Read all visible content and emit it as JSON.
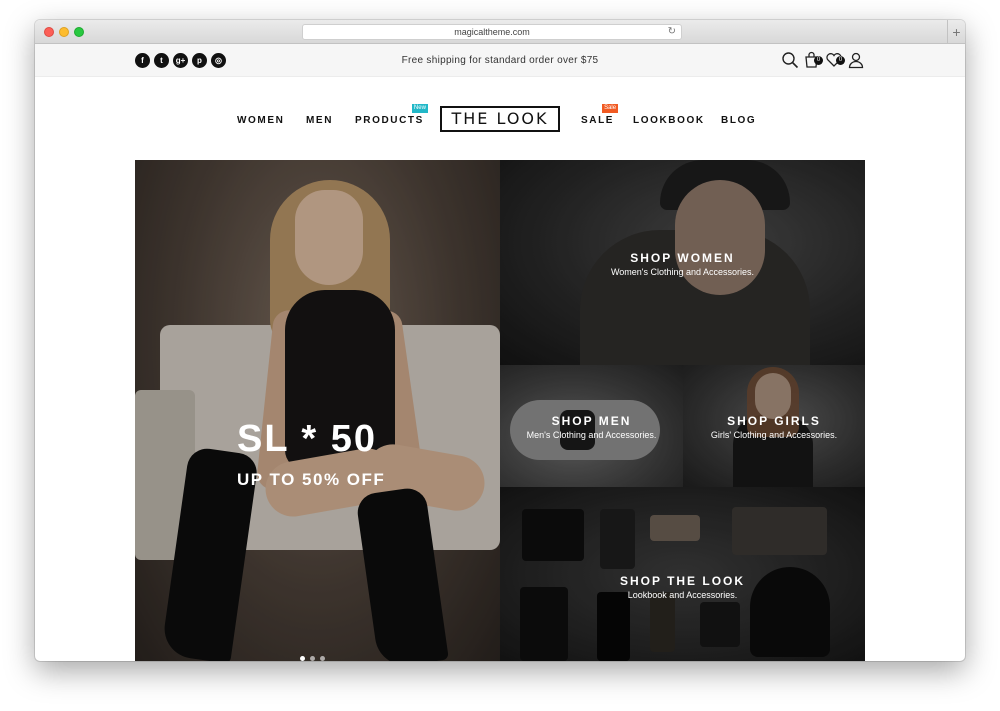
{
  "browser": {
    "url": "magicaltheme.com"
  },
  "topbar": {
    "social_icons": [
      {
        "name": "facebook-icon",
        "glyph": "f"
      },
      {
        "name": "twitter-icon",
        "glyph": "t"
      },
      {
        "name": "google-plus-icon",
        "glyph": "g+"
      },
      {
        "name": "pinterest-icon",
        "glyph": "p"
      },
      {
        "name": "instagram-icon",
        "glyph": "◎"
      }
    ],
    "shipping_text": "Free shipping for standard order over $75",
    "cart_count": "0",
    "wishlist_count": "0"
  },
  "nav": {
    "women": "WOMEN",
    "men": "MEN",
    "products": "PRODUCTS",
    "products_tag": "New",
    "logo": "THE LOOK",
    "sale": "SALE",
    "sale_tag": "Sale",
    "lookbook": "LOOKBOOK",
    "blog": "BLOG"
  },
  "hero": {
    "title": "SL * 50",
    "subtitle": "UP TO 50% OFF"
  },
  "categories": {
    "women": {
      "title": "SHOP WOMEN",
      "sub": "Women's Clothing and Accessories."
    },
    "men": {
      "title": "SHOP MEN",
      "sub": "Men's Clothing and Accessories."
    },
    "girls": {
      "title": "SHOP GIRLS",
      "sub": "Girls' Clothing and Accessories."
    },
    "look": {
      "title": "SHOP THE LOOK",
      "sub": "Lookbook and Accessories."
    }
  },
  "colors": {
    "new_tag": "#21b8c8",
    "sale_tag": "#f15a22",
    "text": "#111111"
  }
}
